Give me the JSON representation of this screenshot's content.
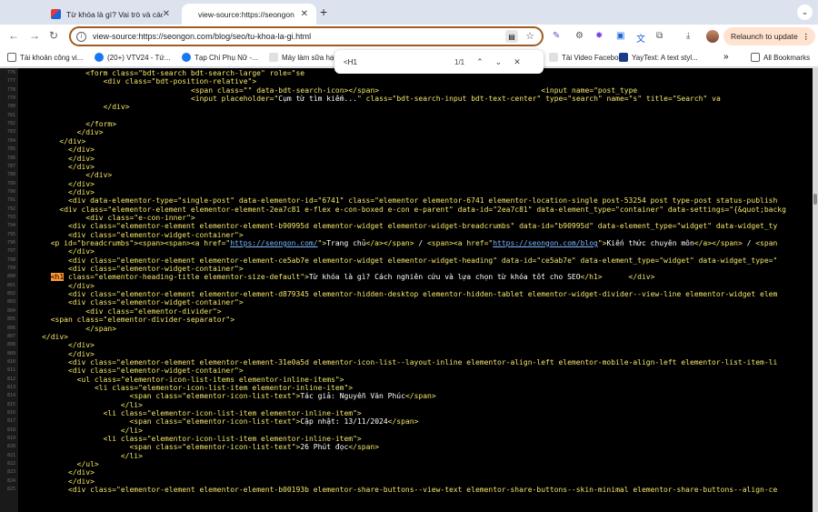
{
  "tabs": [
    {
      "title": "Từ khóa là gì? Vai trò và cách",
      "close": "✕"
    },
    {
      "title": "view-source:https://seongon.",
      "close": "✕"
    }
  ],
  "new_tab": "+",
  "tab_menu": "⌄",
  "toolbar": {
    "back": "←",
    "forward": "→",
    "reload": "↻",
    "url": "view-source:https://seongon.com/blog/seo/tu-khoa-la-gi.html",
    "relaunch": "Relaunch to update",
    "relaunch_menu": "⋮",
    "download_icon": "⤓"
  },
  "bookmarks": [
    {
      "label": "Tài khoản công vi...",
      "color": "#5f6368"
    },
    {
      "label": "(20+) VTV24 - Tứ...",
      "color": "#1877f2"
    },
    {
      "label": "Tạp Chí Phụ Nữ -...",
      "color": "#1877f2"
    },
    {
      "label": "Máy làm sữa hạt",
      "color": "#e0e0e0"
    },
    {
      "label": "Tài Video Faceboo...",
      "color": "#e0e0e0"
    },
    {
      "label": "YayText: A text styl...",
      "color": "#1a3a8a"
    }
  ],
  "all_bookmarks": "All Bookmarks",
  "bookmarks_more": "»",
  "find": {
    "query": "<H1",
    "count": "1/1",
    "prev": "⌃",
    "next": "⌄",
    "close": "✕"
  },
  "source_lines": [
    {
      "n": "776",
      "indent": 15,
      "parts": [
        {
          "t": "<form class=\"bdt-search bdt-search-large\" role=\"se"
        }
      ]
    },
    {
      "n": "777",
      "indent": 19,
      "parts": [
        {
          "t": "<div class=\"bdt-position-relative\">"
        }
      ]
    },
    {
      "n": "778",
      "indent": 39,
      "parts": [
        {
          "t": "<span class=\"\" data-bdt-search-icon></span>                                     <input name=\"post_type"
        }
      ]
    },
    {
      "n": "779",
      "indent": 39,
      "parts": [
        {
          "t": "<input placeholder=\""
        },
        {
          "t": "Cụm từ tìm kiếm...",
          "c": "txt"
        },
        {
          "t": "\" class=\"bdt-search-input bdt-text-center\" type=\"search\" name=\"s\" title=\"Search\" va"
        }
      ]
    },
    {
      "n": "780",
      "indent": 19,
      "parts": [
        {
          "t": "</div>"
        }
      ]
    },
    {
      "n": "781",
      "indent": 0,
      "parts": [
        {
          "t": ""
        }
      ]
    },
    {
      "n": "782",
      "indent": 15,
      "parts": [
        {
          "t": "</form>"
        }
      ]
    },
    {
      "n": "783",
      "indent": 13,
      "parts": [
        {
          "t": "</div>"
        }
      ]
    },
    {
      "n": "784",
      "indent": 9,
      "parts": [
        {
          "t": "</div>"
        }
      ]
    },
    {
      "n": "785",
      "indent": 11,
      "parts": [
        {
          "t": "</div>"
        }
      ]
    },
    {
      "n": "786",
      "indent": 11,
      "parts": [
        {
          "t": "</div>"
        }
      ]
    },
    {
      "n": "787",
      "indent": 11,
      "parts": [
        {
          "t": "</div>"
        }
      ]
    },
    {
      "n": "788",
      "indent": 15,
      "parts": [
        {
          "t": "</div>"
        }
      ]
    },
    {
      "n": "789",
      "indent": 11,
      "parts": [
        {
          "t": "</div>"
        }
      ]
    },
    {
      "n": "790",
      "indent": 11,
      "parts": [
        {
          "t": "</div>"
        }
      ]
    },
    {
      "n": "791",
      "indent": 11,
      "parts": [
        {
          "t": "<div data-elementor-type=\"single-post\" data-elementor-id=\"6741\" class=\"elementor elementor-6741 elementor-location-single post-53254 post type-post status-publish"
        }
      ]
    },
    {
      "n": "792",
      "indent": 9,
      "parts": [
        {
          "t": "<div class=\"elementor-element elementor-element-2ea7c81 e-flex e-con-boxed e-con e-parent\" data-id=\"2ea7c81\" data-element_type=\"container\" data-settings=\"{&quot;backg"
        }
      ]
    },
    {
      "n": "793",
      "indent": 15,
      "parts": [
        {
          "t": "<div class=\"e-con-inner\">"
        }
      ]
    },
    {
      "n": "794",
      "indent": 11,
      "parts": [
        {
          "t": "<div class=\"elementor-element elementor-element-b90995d elementor-widget elementor-widget-breadcrumbs\" data-id=\"b90995d\" data-element_type=\"widget\" data-widget_ty"
        }
      ]
    },
    {
      "n": "795",
      "indent": 11,
      "parts": [
        {
          "t": "<div class=\"elementor-widget-container\">"
        }
      ]
    },
    {
      "n": "796",
      "indent": 7,
      "parts": [
        {
          "t": "<p id=\"breadcrumbs\"><span><span><a href=\""
        },
        {
          "t": "https://seongon.com/",
          "c": "lnk"
        },
        {
          "t": "\">"
        },
        {
          "t": "Trang chủ",
          "c": "txt"
        },
        {
          "t": "</a></span> "
        },
        {
          "t": "/",
          "c": "txt"
        },
        {
          "t": " <span><a href=\""
        },
        {
          "t": "https://seongon.com/blog",
          "c": "lnk"
        },
        {
          "t": "\">"
        },
        {
          "t": "Kiến thức chuyên môn",
          "c": "txt"
        },
        {
          "t": "</a></span> "
        },
        {
          "t": "/",
          "c": "txt"
        },
        {
          "t": " <span"
        }
      ]
    },
    {
      "n": "797",
      "indent": 11,
      "parts": [
        {
          "t": "</div>"
        }
      ]
    },
    {
      "n": "798",
      "indent": 11,
      "parts": [
        {
          "t": "<div class=\"elementor-element elementor-element-ce5ab7e elementor-widget elementor-widget-heading\" data-id=\"ce5ab7e\" data-element_type=\"widget\" data-widget_type=\""
        }
      ]
    },
    {
      "n": "799",
      "indent": 11,
      "parts": [
        {
          "t": "<div class=\"elementor-widget-container\">"
        }
      ]
    },
    {
      "n": "800",
      "indent": 7,
      "parts": [
        {
          "t": "<h1",
          "c": "hl"
        },
        {
          "t": " class=\"elementor-heading-title elementor-size-default\">"
        },
        {
          "t": "Từ khóa là gì? Cách nghiên cứu và lựa chọn từ khóa tốt cho SEO",
          "c": "txt"
        },
        {
          "t": "</h1>      </div>"
        }
      ]
    },
    {
      "n": "801",
      "indent": 11,
      "parts": [
        {
          "t": "</div>"
        }
      ]
    },
    {
      "n": "802",
      "indent": 11,
      "parts": [
        {
          "t": "<div class=\"elementor-element elementor-element-d879345 elementor-hidden-desktop elementor-hidden-tablet elementor-widget-divider--view-line elementor-widget elem"
        }
      ]
    },
    {
      "n": "803",
      "indent": 11,
      "parts": [
        {
          "t": "<div class=\"elementor-widget-container\">"
        }
      ]
    },
    {
      "n": "804",
      "indent": 15,
      "parts": [
        {
          "t": "<div class=\"elementor-divider\">"
        }
      ]
    },
    {
      "n": "805",
      "indent": 7,
      "parts": [
        {
          "t": "<span class=\"elementor-divider-separator\">"
        }
      ]
    },
    {
      "n": "806",
      "indent": 15,
      "parts": [
        {
          "t": "</span>"
        }
      ]
    },
    {
      "n": "807",
      "indent": 5,
      "parts": [
        {
          "t": "</div>"
        }
      ]
    },
    {
      "n": "808",
      "indent": 11,
      "parts": [
        {
          "t": "</div>"
        }
      ]
    },
    {
      "n": "809",
      "indent": 11,
      "parts": [
        {
          "t": "</div>"
        }
      ]
    },
    {
      "n": "810",
      "indent": 11,
      "parts": [
        {
          "t": "<div class=\"elementor-element elementor-element-31e0a5d elementor-icon-list--layout-inline elementor-align-left elementor-mobile-align-left elementor-list-item-li"
        }
      ]
    },
    {
      "n": "811",
      "indent": 11,
      "parts": [
        {
          "t": "<div class=\"elementor-widget-container\">"
        }
      ]
    },
    {
      "n": "812",
      "indent": 13,
      "parts": [
        {
          "t": "<ul class=\"elementor-icon-list-items elementor-inline-items\">"
        }
      ]
    },
    {
      "n": "813",
      "indent": 17,
      "parts": [
        {
          "t": "<li class=\"elementor-icon-list-item elementor-inline-item\">"
        }
      ]
    },
    {
      "n": "814",
      "indent": 25,
      "parts": [
        {
          "t": "<span class=\"elementor-icon-list-text\">"
        },
        {
          "t": "Tác giả: Nguyễn Văn Phúc",
          "c": "txt"
        },
        {
          "t": "</span>"
        }
      ]
    },
    {
      "n": "815",
      "indent": 23,
      "parts": [
        {
          "t": "</li>"
        }
      ]
    },
    {
      "n": "816",
      "indent": 19,
      "parts": [
        {
          "t": "<li class=\"elementor-icon-list-item elementor-inline-item\">"
        }
      ]
    },
    {
      "n": "817",
      "indent": 25,
      "parts": [
        {
          "t": "<span class=\"elementor-icon-list-text\">"
        },
        {
          "t": "Cập nhật: 13/11/2024",
          "c": "txt"
        },
        {
          "t": "</span>"
        }
      ]
    },
    {
      "n": "818",
      "indent": 23,
      "parts": [
        {
          "t": "</li>"
        }
      ]
    },
    {
      "n": "819",
      "indent": 19,
      "parts": [
        {
          "t": "<li class=\"elementor-icon-list-item elementor-inline-item\">"
        }
      ]
    },
    {
      "n": "820",
      "indent": 25,
      "parts": [
        {
          "t": "<span class=\"elementor-icon-list-text\">"
        },
        {
          "t": "26 Phút đọc",
          "c": "txt"
        },
        {
          "t": "</span>"
        }
      ]
    },
    {
      "n": "821",
      "indent": 23,
      "parts": [
        {
          "t": "</li>"
        }
      ]
    },
    {
      "n": "822",
      "indent": 13,
      "parts": [
        {
          "t": "</ul>"
        }
      ]
    },
    {
      "n": "823",
      "indent": 11,
      "parts": [
        {
          "t": "</div>"
        }
      ]
    },
    {
      "n": "824",
      "indent": 11,
      "parts": [
        {
          "t": "</div>"
        }
      ]
    },
    {
      "n": "825",
      "indent": 11,
      "parts": [
        {
          "t": "<div class=\"elementor-element elementor-element-b00193b elementor-share-buttons--view-text elementor-share-buttons--skin-minimal elementor-share-buttons--align-ce"
        }
      ]
    }
  ]
}
